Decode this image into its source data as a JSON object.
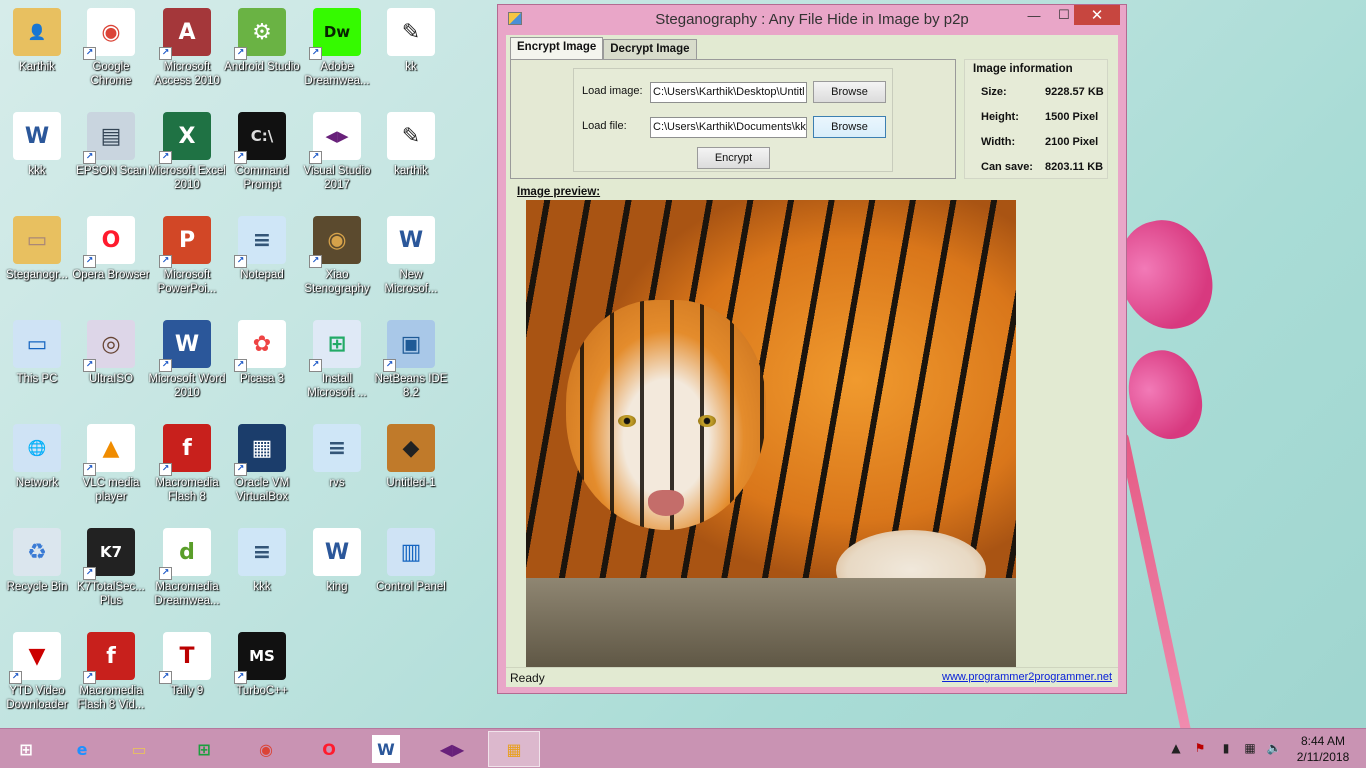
{
  "desktop": {
    "icons": [
      {
        "label": "Karthik",
        "icon": "user-folder-icon",
        "color": "#e8c060",
        "fg": "#3a7",
        "glyph": "👤"
      },
      {
        "label": "Google Chrome",
        "icon": "chrome-icon",
        "color": "#ffffff",
        "fg": "#db4437",
        "glyph": "◉"
      },
      {
        "label": "Microsoft Access 2010",
        "icon": "access-icon",
        "color": "#a4373a",
        "fg": "#fff",
        "glyph": "A"
      },
      {
        "label": "Android Studio",
        "icon": "android-studio-icon",
        "color": "#6ab344",
        "fg": "#fff",
        "glyph": "⚙"
      },
      {
        "label": "Adobe Dreamwea...",
        "icon": "dreamweaver-icon",
        "color": "#35fa00",
        "fg": "#072401",
        "glyph": "Dw"
      },
      {
        "label": "kk",
        "icon": "image-file-icon",
        "color": "#ffffff",
        "fg": "#222",
        "glyph": "✎"
      },
      {
        "label": "kkk",
        "icon": "word-doc-icon",
        "color": "#ffffff",
        "fg": "#2b579a",
        "glyph": "W"
      },
      {
        "label": "EPSON Scan",
        "icon": "scanner-icon",
        "color": "#c9d5df",
        "fg": "#345",
        "glyph": "▤"
      },
      {
        "label": "Microsoft Excel 2010",
        "icon": "excel-icon",
        "color": "#1f7244",
        "fg": "#fff",
        "glyph": "X"
      },
      {
        "label": "Command Prompt",
        "icon": "command-prompt-icon",
        "color": "#111111",
        "fg": "#ddd",
        "glyph": "C:\\"
      },
      {
        "label": "Visual Studio 2017",
        "icon": "visual-studio-icon",
        "color": "#ffffff",
        "fg": "#68217a",
        "glyph": "◀▶"
      },
      {
        "label": "karthik",
        "icon": "image-file-icon",
        "color": "#ffffff",
        "fg": "#222",
        "glyph": "✎"
      },
      {
        "label": "Steganogr...",
        "icon": "folder-icon",
        "color": "#e8c060",
        "fg": "#a87",
        "glyph": "▭"
      },
      {
        "label": "Opera Browser",
        "icon": "opera-icon",
        "color": "#ffffff",
        "fg": "#ff1b2d",
        "glyph": "O"
      },
      {
        "label": "Microsoft PowerPoi...",
        "icon": "powerpoint-icon",
        "color": "#d24726",
        "fg": "#fff",
        "glyph": "P"
      },
      {
        "label": "Notepad",
        "icon": "notepad-icon",
        "color": "#cfe6f7",
        "fg": "#357",
        "glyph": "≡"
      },
      {
        "label": "Xiao Stenography",
        "icon": "xiao-stenography-icon",
        "color": "#5b4a2e",
        "fg": "#d6a24a",
        "glyph": "◉"
      },
      {
        "label": "New Microsof...",
        "icon": "word-doc-icon",
        "color": "#ffffff",
        "fg": "#2b579a",
        "glyph": "W"
      },
      {
        "label": "This PC",
        "icon": "computer-icon",
        "color": "#cfe3f5",
        "fg": "#1565c0",
        "glyph": "▭"
      },
      {
        "label": "UltraISO",
        "icon": "ultraiso-icon",
        "color": "#ddd6e8",
        "fg": "#643",
        "glyph": "◎"
      },
      {
        "label": "Microsoft Word 2010",
        "icon": "word-icon",
        "color": "#2b579a",
        "fg": "#fff",
        "glyph": "W"
      },
      {
        "label": "Picasa 3",
        "icon": "picasa-icon",
        "color": "#ffffff",
        "fg": "#e44",
        "glyph": "✿"
      },
      {
        "label": "Install Microsoft ...",
        "icon": "installer-icon",
        "color": "#dfe9f6",
        "fg": "#2a6",
        "glyph": "⊞"
      },
      {
        "label": "NetBeans IDE 8.2",
        "icon": "netbeans-icon",
        "color": "#a9c8e8",
        "fg": "#1e5a96",
        "glyph": "▣"
      },
      {
        "label": "Network",
        "icon": "network-icon",
        "color": "#cfe3f5",
        "fg": "#1a73c4",
        "glyph": "🌐"
      },
      {
        "label": "VLC media player",
        "icon": "vlc-icon",
        "color": "#ffffff",
        "fg": "#f08c00",
        "glyph": "▲"
      },
      {
        "label": "Macromedia Flash 8",
        "icon": "flash-icon",
        "color": "#c8201c",
        "fg": "#fff",
        "glyph": "f"
      },
      {
        "label": "Oracle VM VirtualBox",
        "icon": "virtualbox-icon",
        "color": "#1b3d6b",
        "fg": "#fff",
        "glyph": "▦"
      },
      {
        "label": "rvs",
        "icon": "notepad-icon",
        "color": "#cfe6f7",
        "fg": "#357",
        "glyph": "≡"
      },
      {
        "label": "Untitled-1",
        "icon": "tiger-image-icon",
        "color": "#c07a2a",
        "fg": "#222",
        "glyph": "◆"
      },
      {
        "label": "Recycle Bin",
        "icon": "recycle-bin-icon",
        "color": "#dbe6ee",
        "fg": "#3a7bd5",
        "glyph": "♻"
      },
      {
        "label": "K7TotalSec... Plus",
        "icon": "k7-icon",
        "color": "#222222",
        "fg": "#fff",
        "glyph": "K7"
      },
      {
        "label": "Macromedia Dreamwea...",
        "icon": "macromedia-dreamweaver-icon",
        "color": "#ffffff",
        "fg": "#5a9e2a",
        "glyph": "d"
      },
      {
        "label": "kkk",
        "icon": "notepad-icon",
        "color": "#cfe6f7",
        "fg": "#357",
        "glyph": "≡"
      },
      {
        "label": "king",
        "icon": "word-doc-icon",
        "color": "#ffffff",
        "fg": "#2b579a",
        "glyph": "W"
      },
      {
        "label": "Control Panel",
        "icon": "control-panel-icon",
        "color": "#cfe3f5",
        "fg": "#1565c0",
        "glyph": "▥"
      },
      {
        "label": "YTD Video Downloader",
        "icon": "ytd-icon",
        "color": "#ffffff",
        "fg": "#c00",
        "glyph": "▼"
      },
      {
        "label": "Macromedia Flash 8 Vid...",
        "icon": "flash-video-icon",
        "color": "#c8201c",
        "fg": "#fff",
        "glyph": "f"
      },
      {
        "label": "Tally 9",
        "icon": "tally-icon",
        "color": "#ffffff",
        "fg": "#b00",
        "glyph": "T"
      },
      {
        "label": "TurboC++",
        "icon": "turboc-icon",
        "color": "#111111",
        "fg": "#fff",
        "glyph": "MS"
      }
    ]
  },
  "window": {
    "title": "Steganography : Any File Hide in Image by p2p",
    "minimize": "—",
    "maximize": "☐",
    "close": "✕",
    "tabs": [
      {
        "label": "Encrypt Image",
        "active": true
      },
      {
        "label": "Decrypt Image",
        "active": false
      }
    ],
    "load_image_label": "Load image:",
    "load_image_value": "C:\\Users\\Karthik\\Desktop\\Untitl",
    "load_file_label": "Load file:",
    "load_file_value": "C:\\Users\\Karthik\\Documents\\kk",
    "browse_label": "Browse",
    "encrypt_label": "Encrypt",
    "info": {
      "title": "Image information",
      "rows": [
        {
          "label": "Size:",
          "value": "9228.57 KB"
        },
        {
          "label": "Height:",
          "value": "1500 Pixel"
        },
        {
          "label": "Width:",
          "value": "2100 Pixel"
        },
        {
          "label": "Can save:",
          "value": "8203.11 KB"
        }
      ]
    },
    "preview_label": "Image preview:",
    "status": "Ready",
    "link": "www.programmer2programmer.net"
  },
  "taskbar": {
    "items": [
      {
        "name": "start-button",
        "glyph": "⊞",
        "color": "#ffffff"
      },
      {
        "name": "internet-explorer-taskbar",
        "glyph": "e",
        "color": "#1e90ff"
      },
      {
        "name": "file-explorer-taskbar",
        "glyph": "▭",
        "color": "#e8c060"
      },
      {
        "name": "store-taskbar",
        "glyph": "⊞",
        "color": "#1b9e3e"
      },
      {
        "name": "chrome-taskbar",
        "glyph": "◉",
        "color": "#db4437"
      },
      {
        "name": "opera-taskbar",
        "glyph": "O",
        "color": "#ff1b2d"
      },
      {
        "name": "word-taskbar",
        "glyph": "W",
        "color": "#2b579a"
      },
      {
        "name": "visual-studio-taskbar",
        "glyph": "◀▶",
        "color": "#68217a"
      },
      {
        "name": "steganography-taskbar",
        "glyph": "▦",
        "color": "#e8a020"
      }
    ],
    "clock_time": "8:44 AM",
    "clock_date": "2/11/2018"
  }
}
